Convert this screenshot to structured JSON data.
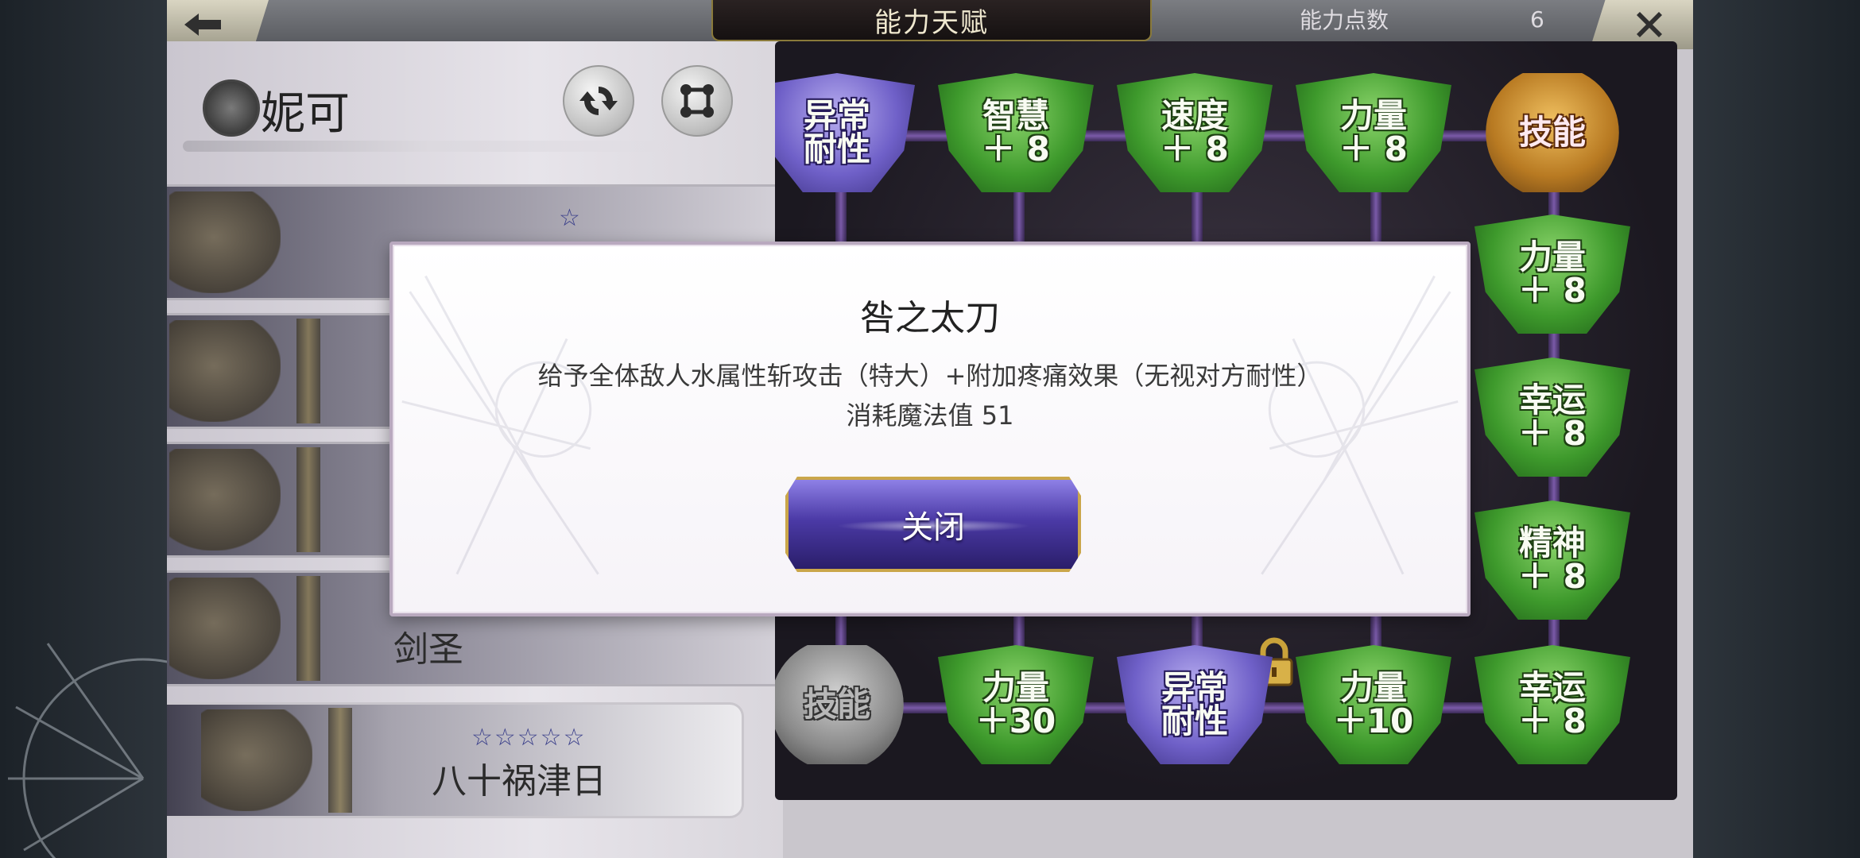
{
  "header": {
    "title": "能力天赋",
    "points_label": "能力点数",
    "points_value": "6"
  },
  "character": {
    "name": "妮可"
  },
  "roster": [
    {
      "stars": "☆",
      "name": ""
    },
    {
      "stars": "",
      "name": ""
    },
    {
      "stars": "",
      "name": ""
    },
    {
      "stars": "",
      "name": "剑圣"
    },
    {
      "stars": "☆☆☆☆☆",
      "name": "八十祸津日"
    }
  ],
  "grid": {
    "row1": [
      {
        "type": "purple",
        "line1": "异常",
        "line2": "耐性"
      },
      {
        "type": "green",
        "line1": "智慧",
        "line2": "＋ 8"
      },
      {
        "type": "green",
        "line1": "速度",
        "line2": "＋ 8"
      },
      {
        "type": "green",
        "line1": "力量",
        "line2": "＋ 8"
      },
      {
        "type": "gold",
        "line1": "技能",
        "line2": ""
      }
    ],
    "right_col": [
      {
        "type": "green",
        "line1": "力量",
        "line2": "＋ 8"
      },
      {
        "type": "green",
        "line1": "幸运",
        "line2": "＋ 8"
      },
      {
        "type": "green",
        "line1": "精神",
        "line2": "＋ 8"
      }
    ],
    "bottom_row": [
      {
        "type": "silver",
        "line1": "技能",
        "line2": ""
      },
      {
        "type": "green",
        "line1": "力量",
        "line2": "＋30",
        "locked": true
      },
      {
        "type": "purple",
        "line1": "异常",
        "line2": "耐性"
      },
      {
        "type": "green",
        "line1": "力量",
        "line2": "＋10"
      },
      {
        "type": "green",
        "line1": "幸运",
        "line2": "＋ 8"
      }
    ]
  },
  "modal": {
    "title": "咎之太刀",
    "description": "给予全体敌人水属性斩攻击（特大）+附加疼痛效果（无视对方耐性）",
    "cost": "消耗魔法值 51",
    "close_label": "关闭"
  },
  "icons": {
    "back": "back-arrow-icon",
    "close": "close-icon",
    "refresh": "refresh-icon",
    "nodes": "nodes-icon",
    "lock": "lock-icon",
    "emblem": "character-emblem-icon"
  }
}
